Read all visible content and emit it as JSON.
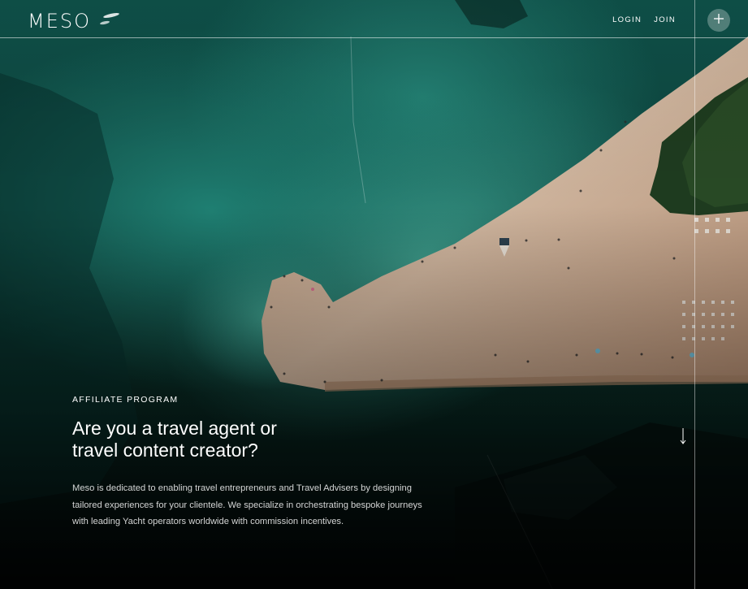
{
  "brand": {
    "logo_text": "MESO"
  },
  "nav": {
    "login": "LOGIN",
    "join": "JOIN"
  },
  "hero": {
    "eyebrow": "AFFILIATE PROGRAM",
    "headline_line1": "Are you a travel agent or",
    "headline_line2": "travel content creator?",
    "description": "Meso is dedicated to enabling travel entrepreneurs and Travel Advisers by designing tailored experiences for your clientele. We specialize in orchestrating bespoke journeys with leading Yacht operators worldwide with commission incentives."
  },
  "icons": [
    "boat-icon",
    "plus-icon",
    "scroll-down-arrow-icon"
  ],
  "colors": {
    "sea": "#1f7f72",
    "sand": "#c9a88a",
    "deep": "#061412",
    "text": "#ffffff"
  }
}
